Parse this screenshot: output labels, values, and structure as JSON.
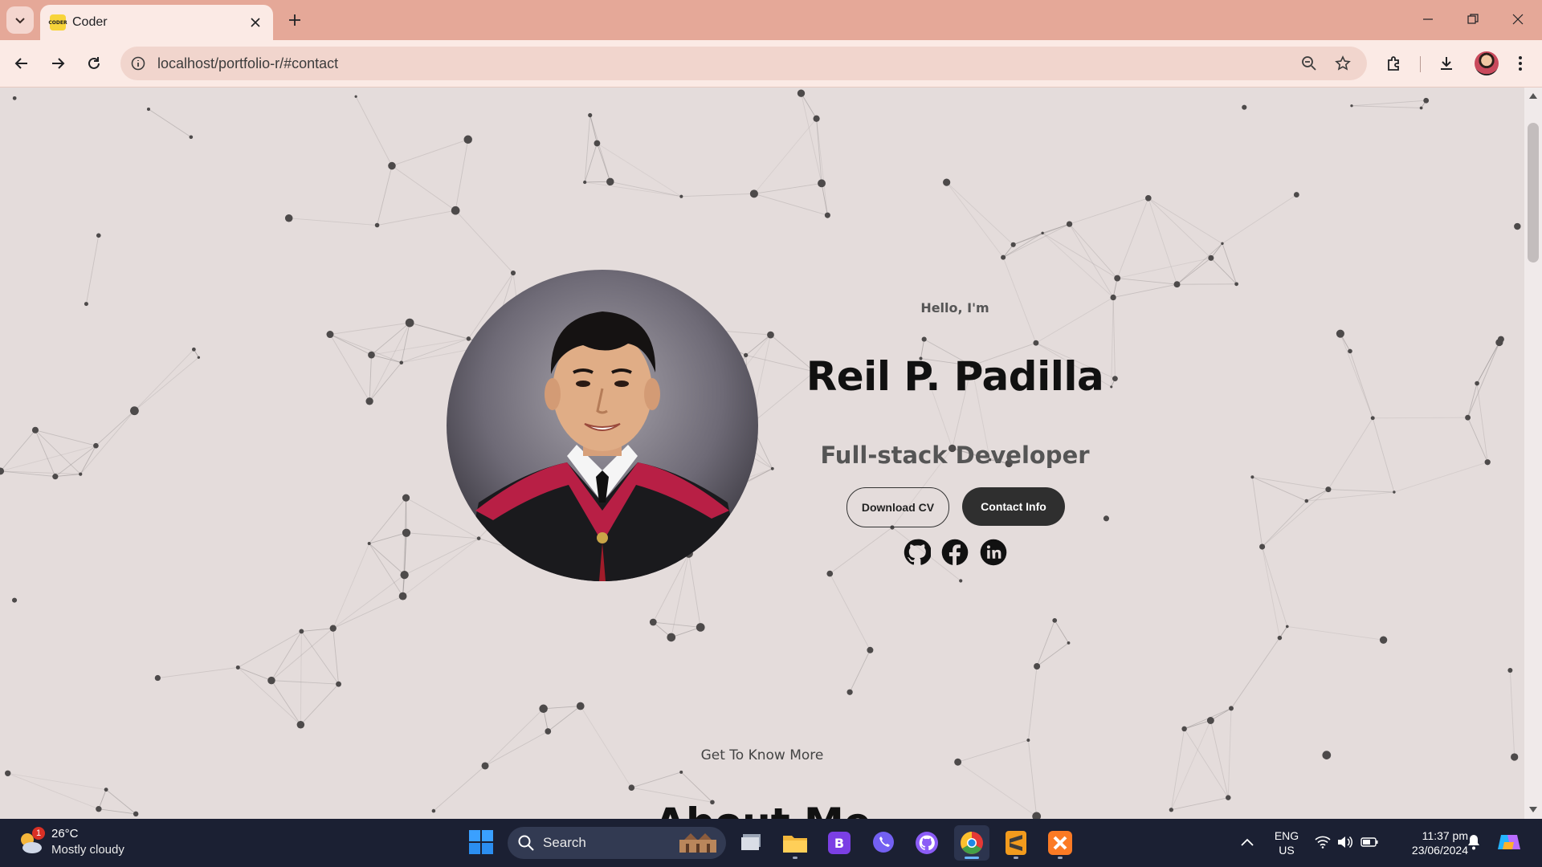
{
  "browser": {
    "tab_title": "Coder",
    "favicon_text": "CODER",
    "url": "localhost/portfolio-r/#contact"
  },
  "hero": {
    "greeting": "Hello, I'm",
    "name": "Reil P. Padilla",
    "role": "Full-stack Developer",
    "download_cv_label": "Download CV",
    "contact_label": "Contact Info",
    "social_icons": [
      "github-icon",
      "facebook-icon",
      "linkedin-icon"
    ]
  },
  "next_section": {
    "scroll_hint": "Get To Know More",
    "heading": "About Me"
  },
  "taskbar": {
    "weather_badge": "1",
    "weather_temp": "26°C",
    "weather_desc": "Mostly cloudy",
    "search_label": "Search",
    "language_line1": "ENG",
    "language_line2": "US",
    "time": "11:37 pm",
    "date": "23/06/2024",
    "apps": [
      "file-manager",
      "file-explorer",
      "bootstrap-app",
      "viber",
      "github-desktop",
      "chrome",
      "sublime-text",
      "xampp"
    ]
  },
  "colors": {
    "tabbar": "#e5a898",
    "toolbar": "#fbeae5",
    "page_background": "#e4dcdb",
    "button_dark": "#2f2f2f",
    "taskbar": "#1b2033"
  }
}
